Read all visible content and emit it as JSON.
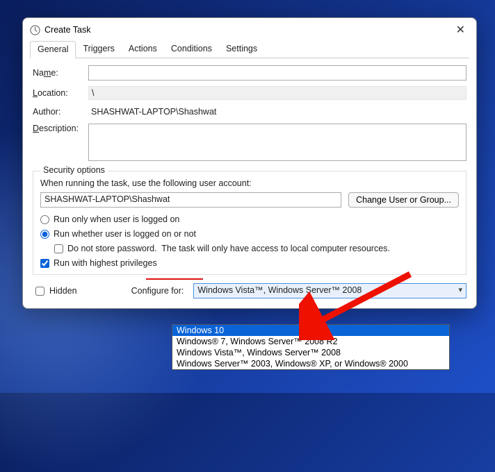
{
  "window": {
    "title": "Create Task"
  },
  "tabs": [
    "General",
    "Triggers",
    "Actions",
    "Conditions",
    "Settings"
  ],
  "labels": {
    "name": "Name:",
    "name_u": "m",
    "location": "Location:",
    "location_u": "L",
    "author": "Author:",
    "description": "Description:",
    "description_u": "D",
    "security_group": "Security options",
    "ua_prompt": "When running the task, use the following user account:",
    "change_user": "Change User or Group...",
    "radio_logged_on": "Run only when user is logged on",
    "radio_logged_on_u": "R",
    "radio_any": "Run whether user is logged on or not",
    "radio_any_u": "w",
    "nostore": "Do not store password.  The task will only have access to local computer resources.",
    "nostore_u": "p",
    "highest": "Run with highest privileges",
    "highest_u": "i",
    "hidden": "Hidden",
    "hidden_u": "e",
    "configure": "Configure for:",
    "configure_u": "C"
  },
  "values": {
    "location": "\\",
    "author": "SHASHWAT-LAPTOP\\Shashwat",
    "user_account": "SHASHWAT-LAPTOP\\Shashwat",
    "configure_selected": "Windows Vista™, Windows Server™ 2008"
  },
  "dropdown": {
    "selected_index": 0,
    "items": [
      "Windows 10",
      "Windows® 7, Windows Server™ 2008 R2",
      "Windows Vista™, Windows Server™ 2008",
      "Windows Server™ 2003, Windows® XP, or Windows® 2000"
    ]
  }
}
